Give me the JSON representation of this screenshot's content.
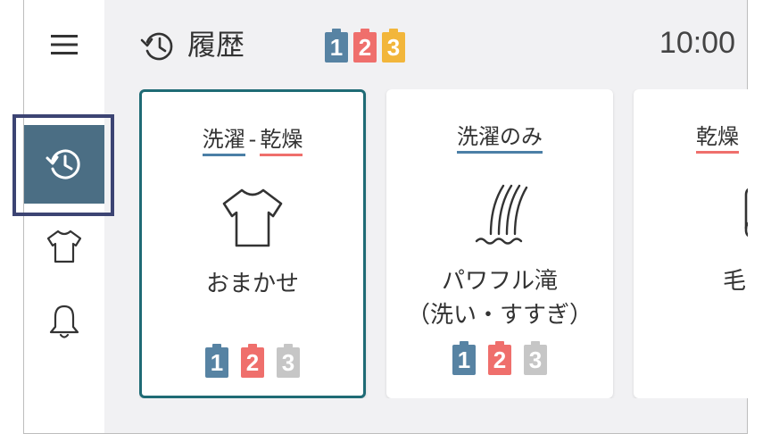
{
  "header": {
    "title": "履歴",
    "clock": "10:00",
    "batteries": [
      {
        "num": "1",
        "color": "#5783a3"
      },
      {
        "num": "2",
        "color": "#ef6f6c"
      },
      {
        "num": "3",
        "color": "#f2b63b"
      }
    ]
  },
  "sidebar": {
    "items": [
      {
        "name": "menu",
        "icon": "hamburger-menu-icon",
        "active": false
      },
      {
        "name": "history",
        "icon": "history-clock-icon",
        "active": true
      },
      {
        "name": "laundry",
        "icon": "shirt-icon",
        "active": false
      },
      {
        "name": "notifications",
        "icon": "bell-icon",
        "active": false
      }
    ]
  },
  "cards": [
    {
      "mode_a": "洗濯",
      "mode_sep": "-",
      "mode_b": "乾燥",
      "icon": "shirt-icon",
      "name": "おまかせ",
      "selected": true,
      "batteries": [
        {
          "num": "1",
          "on": true
        },
        {
          "num": "2",
          "on": true
        },
        {
          "num": "3",
          "on": false
        }
      ]
    },
    {
      "mode_a": "洗濯のみ",
      "icon": "waterfall-icon",
      "name_line1": "パワフル滝",
      "name_line2": "（洗い・すすぎ）",
      "selected": false,
      "batteries": [
        {
          "num": "1",
          "on": true
        },
        {
          "num": "2",
          "on": true
        },
        {
          "num": "3",
          "on": false
        }
      ]
    },
    {
      "mode_b": "乾燥",
      "icon": "blanket-icon",
      "name": "毛",
      "selected": false
    }
  ],
  "colors": {
    "accent_blue": "#4b6e84",
    "selected_border": "#1f6b75",
    "focus_ring": "#3c4473",
    "underline_blue": "#4b7fa6",
    "underline_red": "#ef6f6c"
  }
}
